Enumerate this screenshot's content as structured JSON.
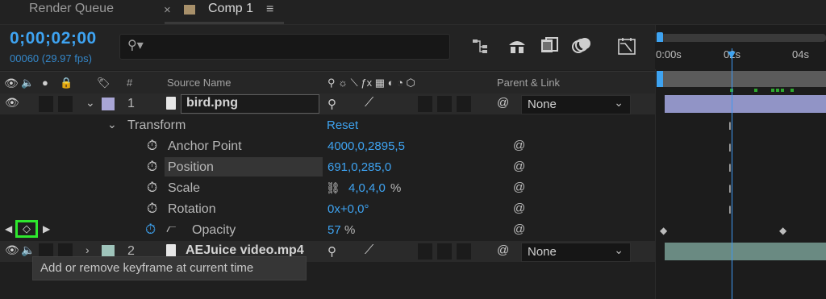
{
  "tabs": {
    "render_queue": "Render Queue",
    "comp": "Comp 1"
  },
  "timecode": "0;00;02;00",
  "frames_fps": "00060 (29.97 fps)",
  "columns": {
    "hash": "#",
    "source_name": "Source Name",
    "parent_link": "Parent & Link"
  },
  "timeline": {
    "ruler": [
      "0:00s",
      "02s",
      "04s"
    ]
  },
  "layers": [
    {
      "number": "1",
      "name": "bird.png",
      "parent": "None",
      "color": "#a9a6d6"
    },
    {
      "number": "2",
      "name": "AEJuice video.mp4",
      "parent": "None",
      "color": "#9fc4bb"
    }
  ],
  "transform": {
    "label": "Transform",
    "reset": "Reset",
    "props": [
      {
        "name": "Anchor Point",
        "value": "4000,0,2895,5"
      },
      {
        "name": "Position",
        "value": "691,0,285,0"
      },
      {
        "name": "Scale",
        "value": "4,0,4,0",
        "unit": "%"
      },
      {
        "name": "Rotation",
        "value": "0x+0,0°"
      },
      {
        "name": "Opacity",
        "value": "57",
        "unit": "%"
      }
    ]
  },
  "tooltip": "Add or remove keyframe at current time"
}
